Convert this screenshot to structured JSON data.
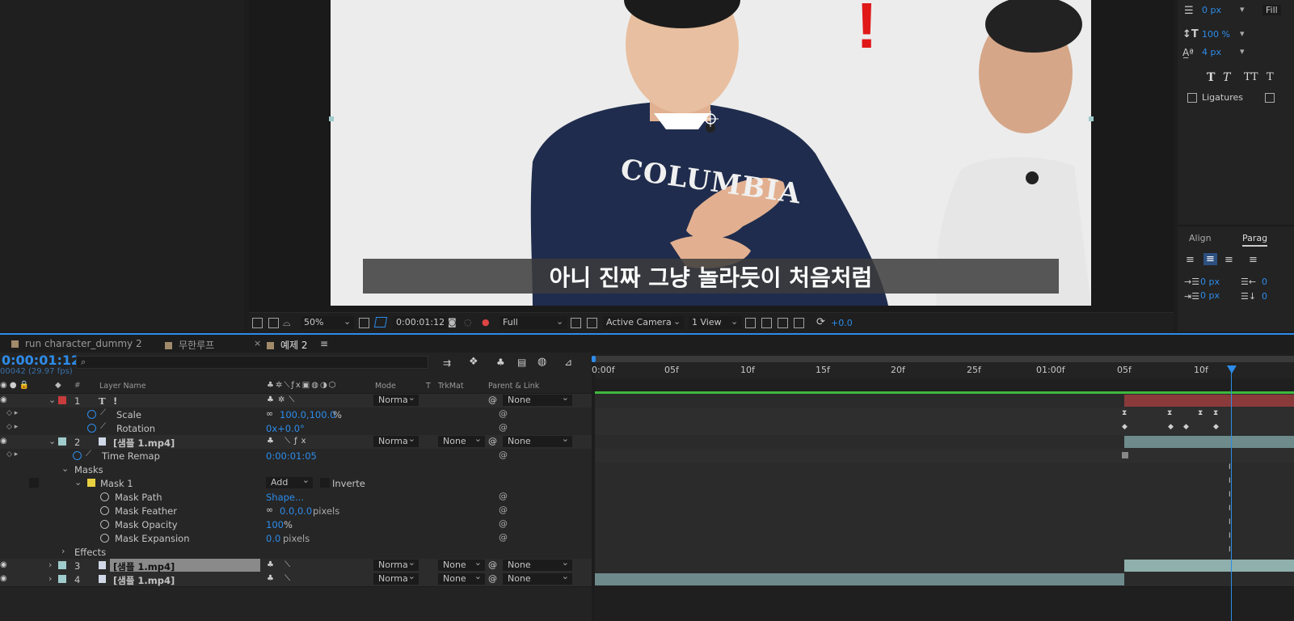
{
  "viewer": {
    "subtitle": "아니 진짜 그냥 놀라듯이 처음처럼",
    "zoom": "50%",
    "timecode": "0:00:01:12",
    "resolution": "Full",
    "camera": "Active Camera",
    "views": "1 View",
    "exposure": "+0.0",
    "shirt_text": "COLUMBIA",
    "exclamation": "!"
  },
  "char_panel": {
    "stroke_value": "0 px",
    "fill_mode": "Fill",
    "vscale_value": "100 %",
    "baseline_value": "4 px",
    "style_buttons": [
      "T",
      "T",
      "TT",
      "T"
    ],
    "ligatures_label": "Ligatures"
  },
  "para_panel": {
    "tab_align": "Align",
    "tab_paragraph": "Parag",
    "indent_left": "0 px",
    "indent_first": "0 px",
    "indent_right": "0",
    "space_after": "0"
  },
  "tabs": [
    {
      "label": "run character_dummy 2",
      "color": "#a08a6a"
    },
    {
      "label": "무한루프",
      "color": "#a08a6a"
    },
    {
      "label": "예제 2",
      "color": "#a08a6a",
      "active": true
    }
  ],
  "timeline": {
    "current_time": "0:00:01:12",
    "frame_info": "00042 (29.97 fps)",
    "search_placeholder": "",
    "col_hash": "#",
    "col_layer_name": "Layer Name",
    "col_mode": "Mode",
    "col_t": "T",
    "col_trkmat": "TrkMat",
    "col_parent": "Parent & Link",
    "ruler": [
      "0:00f",
      "05f",
      "10f",
      "15f",
      "20f",
      "25f",
      "01:00f",
      "05f",
      "10f"
    ],
    "rows": {
      "l1_num": "1",
      "l1_name": "!",
      "l1_mode": "Norma",
      "l1_parent": "None",
      "l1_icon": "T",
      "scale_label": "Scale",
      "scale_value": "100.0,100.0",
      "scale_unit": "%",
      "rotation_label": "Rotation",
      "rotation_value": "0x+0.0°",
      "l2_num": "2",
      "l2_name": "[샘플 1.mp4]",
      "l2_mode": "Norma",
      "l2_trk": "None",
      "l2_parent": "None",
      "timeremap_label": "Time Remap",
      "timeremap_value": "0:00:01:05",
      "masks_label": "Masks",
      "mask1_label": "Mask 1",
      "mask1_mode": "Add",
      "mask1_invert": "Inverte",
      "maskpath_label": "Mask Path",
      "maskpath_value": "Shape...",
      "maskfeather_label": "Mask Feather",
      "maskfeather_value": "0.0,0.0",
      "maskfeather_unit": "pixels",
      "maskopacity_label": "Mask Opacity",
      "maskopacity_value": "100",
      "maskopacity_unit": "%",
      "maskexp_label": "Mask Expansion",
      "maskexp_value": "0.0",
      "maskexp_unit": "pixels",
      "effects_label": "Effects",
      "l3_num": "3",
      "l3_name": "[샘플 1.mp4]",
      "l3_mode": "Norma",
      "l3_trk": "None",
      "l3_parent": "None",
      "l4_num": "4",
      "l4_name": "[샘플 1.mp4]",
      "l4_mode": "Norma",
      "l4_trk": "None",
      "l4_parent": "None"
    }
  },
  "colors": {
    "accent": "#2d8ceb",
    "label_red": "#c83c3c",
    "label_teal": "#9fcccc",
    "mask_yellow": "#e8d040"
  }
}
